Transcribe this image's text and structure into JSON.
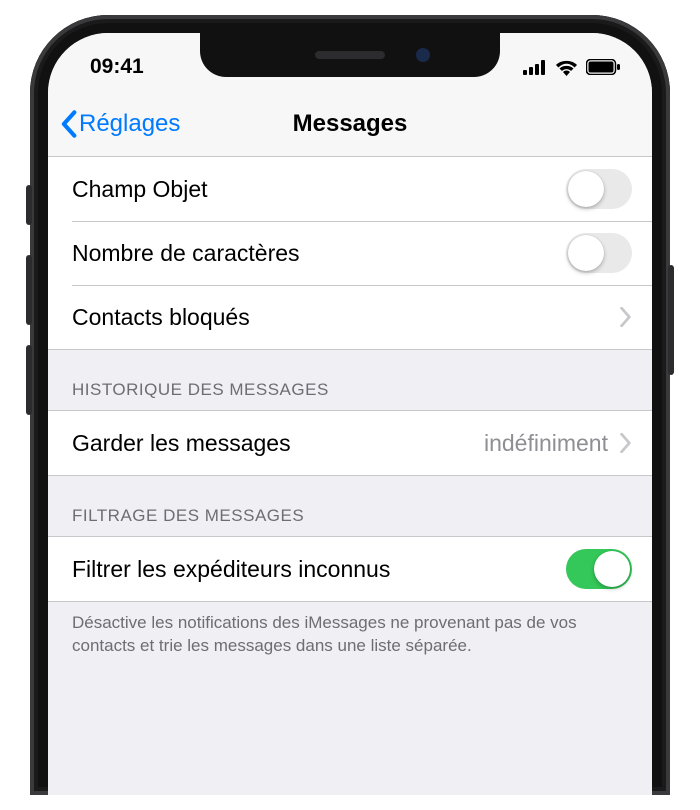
{
  "status": {
    "time": "09:41"
  },
  "nav": {
    "back": "Réglages",
    "title": "Messages"
  },
  "rows": {
    "subject": {
      "label": "Champ Objet",
      "on": false
    },
    "charCount": {
      "label": "Nombre de caractères",
      "on": false
    },
    "blocked": {
      "label": "Contacts bloqués"
    },
    "historyHeader": "HISTORIQUE DES MESSAGES",
    "keep": {
      "label": "Garder les messages",
      "value": "indéfiniment"
    },
    "filterHeader": "FILTRAGE DES MESSAGES",
    "filterUnknown": {
      "label": "Filtrer les expéditeurs inconnus",
      "on": true
    },
    "filterFooter": "Désactive les notifications des iMessages ne provenant pas de vos contacts et trie les messages dans une liste séparée."
  },
  "colors": {
    "accent": "#007aff",
    "switchOn": "#34c759"
  }
}
